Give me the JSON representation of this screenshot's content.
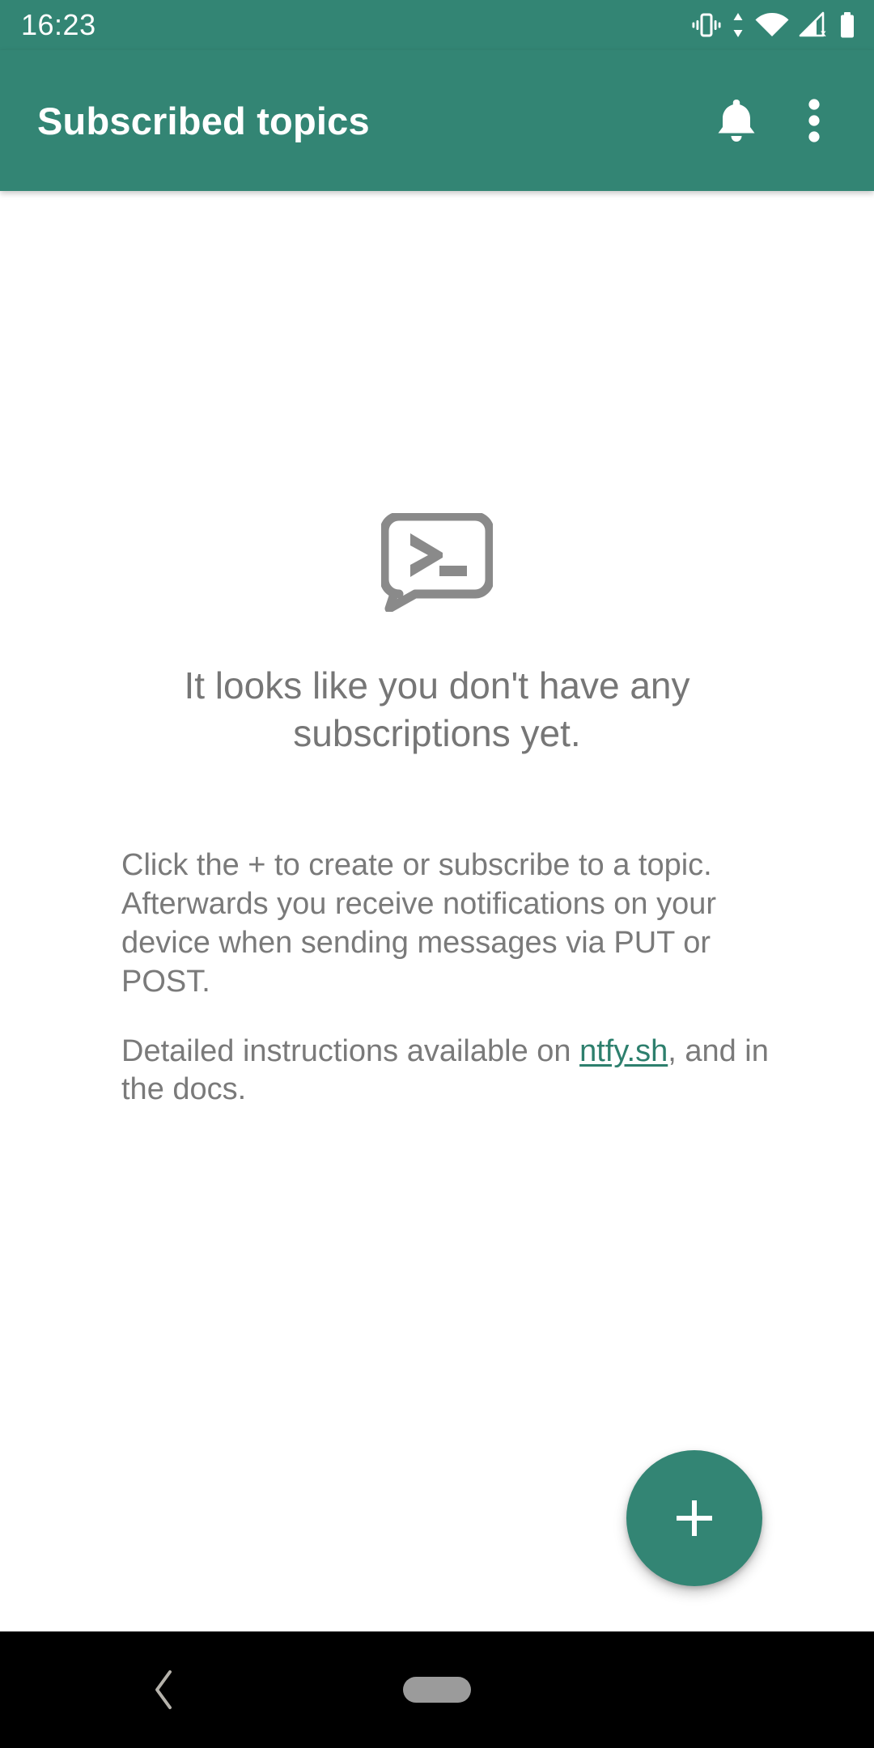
{
  "status_bar": {
    "clock": "16:23",
    "icons": [
      {
        "name": "vibrate-icon",
        "label": "vibrate"
      },
      {
        "name": "data-transfer-icon",
        "label": "data up down"
      },
      {
        "name": "wifi-icon",
        "label": "wifi full"
      },
      {
        "name": "cellular-signal-off-icon",
        "label": "no cellular signal"
      },
      {
        "name": "battery-full-icon",
        "label": "battery full"
      }
    ]
  },
  "app_bar": {
    "title": "Subscribed topics",
    "actions": [
      {
        "name": "notification-bell-button",
        "label": "Notifications"
      },
      {
        "name": "overflow-menu-button",
        "label": "More options"
      }
    ]
  },
  "empty_state": {
    "illustration": "terminal-speech-bubble-icon",
    "heading": "It looks like you don't have any subscriptions yet.",
    "paragraph_1": "Click the + to create or subscribe to a topic. Afterwards you receive notifications on your device when sending messages via PUT or POST.",
    "paragraph_2_before_link": "Detailed instructions available on ",
    "link_text": "ntfy.sh",
    "paragraph_2_after_link": ", and in the docs."
  },
  "fab": {
    "name": "add-subscription-fab",
    "label": "+"
  },
  "nav_bar": {
    "back_label": "Back",
    "home_label": "Home"
  },
  "colors": {
    "accent": "#338574",
    "app_bar": "#338574",
    "link": "#2d7f6d",
    "body_text": "#7a7a7a",
    "heading_text": "#767676",
    "illustration": "#8a8a8a",
    "nav_bar": "#000000",
    "background": "#ffffff"
  }
}
